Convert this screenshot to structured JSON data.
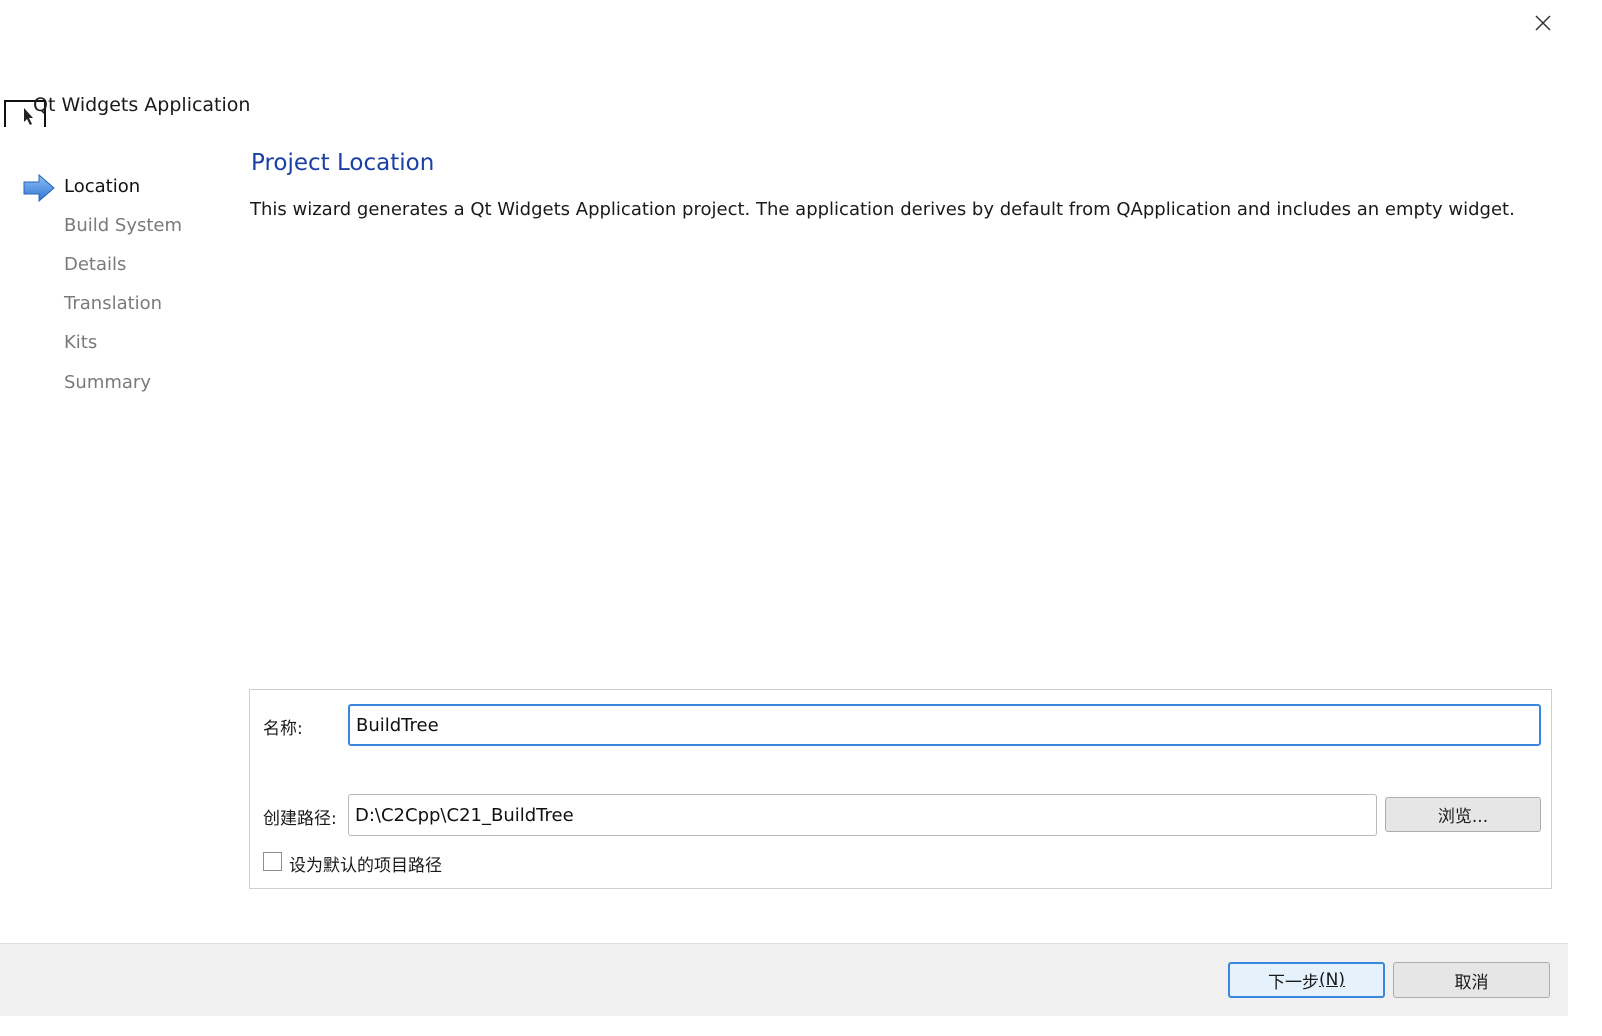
{
  "wizard": {
    "title": "Qt Widgets Application",
    "close_icon": "close-icon"
  },
  "steps": [
    {
      "label": "Location",
      "current": true
    },
    {
      "label": "Build System",
      "current": false
    },
    {
      "label": "Details",
      "current": false
    },
    {
      "label": "Translation",
      "current": false
    },
    {
      "label": "Kits",
      "current": false
    },
    {
      "label": "Summary",
      "current": false
    }
  ],
  "page": {
    "heading": "Project Location",
    "description": "This wizard generates a Qt Widgets Application project. The application derives by default from QApplication and includes an empty widget."
  },
  "form": {
    "name_label": "名称:",
    "name_value": "BuildTree",
    "path_label": "创建路径:",
    "path_value": "D:\\C2Cpp\\C21_BuildTree",
    "browse_label": "浏览...",
    "default_checkbox_label": "设为默认的项目路径",
    "default_checked": false
  },
  "footer": {
    "next_label": "下一步",
    "next_mnemonic": "(N)",
    "cancel_label": "取消"
  },
  "colors": {
    "heading": "#1a3fa5",
    "focus_border": "#3b86e0",
    "inactive_step": "#7a7a7a"
  }
}
